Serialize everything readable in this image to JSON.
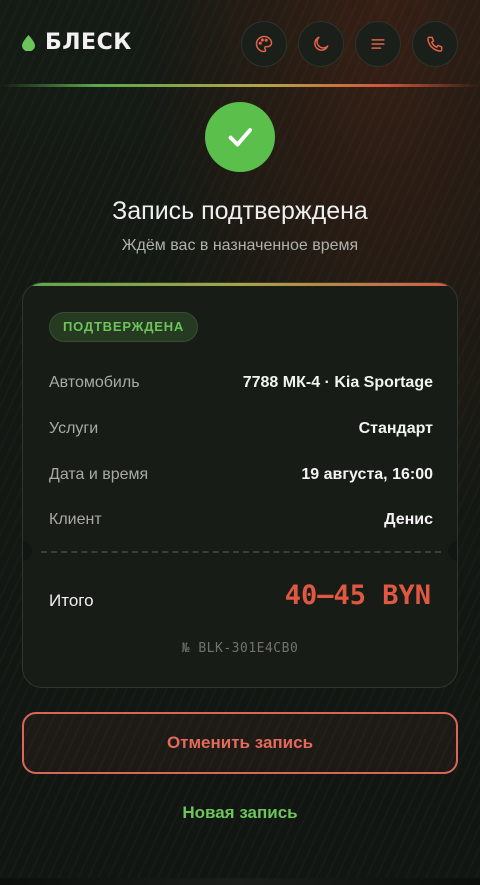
{
  "header": {
    "logo_text": "БЛЕСК",
    "actions": [
      {
        "icon": "palette-icon"
      },
      {
        "icon": "moon-icon"
      },
      {
        "icon": "menu-icon"
      },
      {
        "icon": "phone-icon"
      }
    ]
  },
  "confirmation": {
    "title": "Запись подтверждена",
    "subtitle": "Ждём вас в назначенное время"
  },
  "card": {
    "status_badge": "ПОДТВЕРЖДЕНА",
    "rows": [
      {
        "label": "Автомобиль",
        "value": "7788 МК-4 · Kia Sportage"
      },
      {
        "label": "Услуги",
        "value": "Стандарт"
      },
      {
        "label": "Дата и время",
        "value": "19 августа, 16:00"
      },
      {
        "label": "Клиент",
        "value": "Денис"
      }
    ],
    "total_label": "Итого",
    "total_value": "40–45 BYN",
    "reference": "№ BLK-301E4CB0"
  },
  "actions": {
    "cancel_label": "Отменить запись",
    "new_label": "Новая запись"
  },
  "colors": {
    "accent_green": "#5bbf4b",
    "accent_red": "#df5842",
    "background": "#121612"
  }
}
